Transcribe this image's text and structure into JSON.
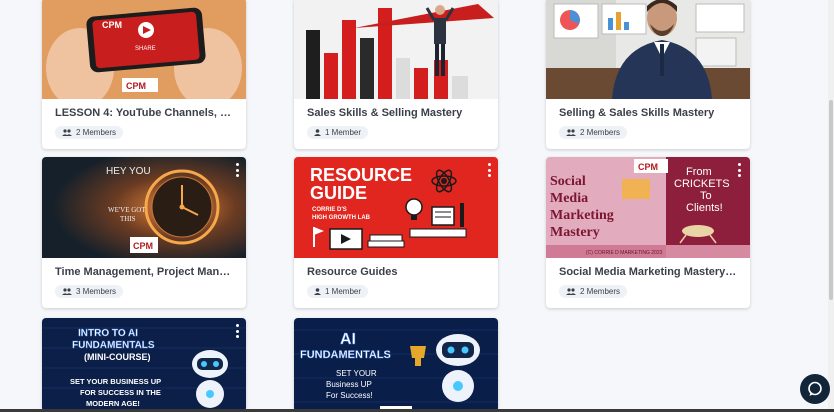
{
  "cards": [
    {
      "title": "LESSON 4: YouTube Channels, Vid...",
      "members": "2 Members",
      "thumb": {
        "brand": "CPM",
        "share": "SHARE"
      }
    },
    {
      "title": "Sales Skills & Selling Mastery",
      "members": "1 Member",
      "thumb": {}
    },
    {
      "title": "Selling & Sales Skills Mastery",
      "members": "2 Members",
      "thumb": {}
    },
    {
      "title": "Time Management, Project Mana...",
      "members": "3 Members",
      "thumb": {
        "line1": "HEY YOU",
        "line2": "WE'VE GOT",
        "line3": "THIS",
        "brand": "CPM"
      }
    },
    {
      "title": "Resource Guides",
      "members": "1 Member",
      "thumb": {
        "line1": "RESOURCE",
        "line2": "GUIDE",
        "line3": "CORRIE D'S",
        "line4": "HIGH GROWTH LAB"
      }
    },
    {
      "title": "Social Media Marketing Mastery: ...",
      "members": "2 Members",
      "thumb": {
        "line1": "Social",
        "line2": "Media",
        "line3": "Marketing",
        "line4": "Mastery",
        "right1": "From",
        "right2": "CRICKETS",
        "right3": "To",
        "right4": "Clients!",
        "footer": "(C) CORRIE D MARKETING 2023",
        "brand": "CPM"
      }
    },
    {
      "title": "",
      "members": "",
      "thumb": {
        "line1": "INTRO TO AI",
        "line2": "FUNDAMENTALS",
        "line3": "(MINI-COURSE)",
        "line4": "SET YOUR BUSINESS UP",
        "line5": "FOR SUCCESS IN THE",
        "line6": "MODERN AGE!"
      }
    },
    {
      "title": "",
      "members": "",
      "thumb": {
        "line1": "AI",
        "line2": "FUNDAMENTALS",
        "line3": "SET YOUR",
        "line4": "Business UP",
        "line5": "For Success!"
      }
    }
  ],
  "icons": {
    "members": "people-icon",
    "member": "person-icon",
    "menu": "more-vertical-icon",
    "chat": "chat-icon"
  },
  "colors": {
    "background": "#f5f7fb",
    "resource_red": "#e0261f",
    "social_pink": "#c4587a",
    "ai_navy": "#0c1f48"
  }
}
